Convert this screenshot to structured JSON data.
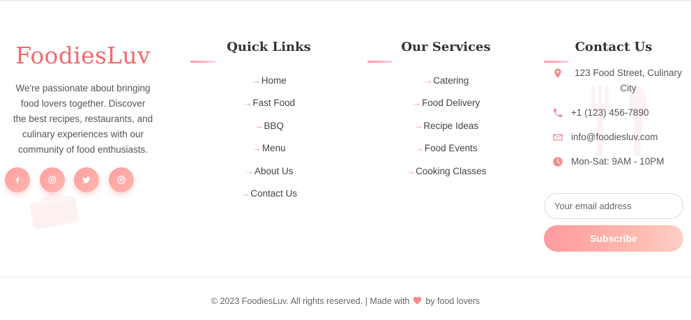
{
  "brand": {
    "name": "FoodiesLuv",
    "about_lines": [
      "We're passionate about bringing",
      "food lovers together. Discover",
      "the best recipes, restaurants, and",
      "culinary experiences with our",
      "community of food enthusiasts."
    ],
    "socials": [
      "facebook-icon",
      "instagram-icon",
      "twitter-icon",
      "pinterest-icon"
    ]
  },
  "quick_links": {
    "title": "Quick Links",
    "arrow": "→",
    "items": [
      "Home",
      "Fast Food",
      "BBQ",
      "Menu",
      "About Us",
      "Contact Us"
    ]
  },
  "services": {
    "title": "Our Services",
    "arrow": "→",
    "items": [
      "Catering",
      "Food Delivery",
      "Recipe Ideas",
      "Food Events",
      "Cooking Classes"
    ]
  },
  "contact": {
    "title": "Contact Us",
    "address": "123 Food Street, Culinary City",
    "phone": "+1 (123) 456-7890",
    "email": "info@foodiesluv.com",
    "hours": "Mon-Sat: 9AM - 10PM",
    "newsletter_placeholder": "Your email address",
    "subscribe_label": "Subscribe"
  },
  "footer": {
    "copyright_prefix": "© 2023 FoodiesLuv. All rights reserved. | Made with",
    "copyright_suffix": "by food lovers"
  },
  "colors": {
    "accent": "#f26a6e",
    "gradient_start": "#ff9a9e",
    "gradient_end": "#fecfef"
  }
}
